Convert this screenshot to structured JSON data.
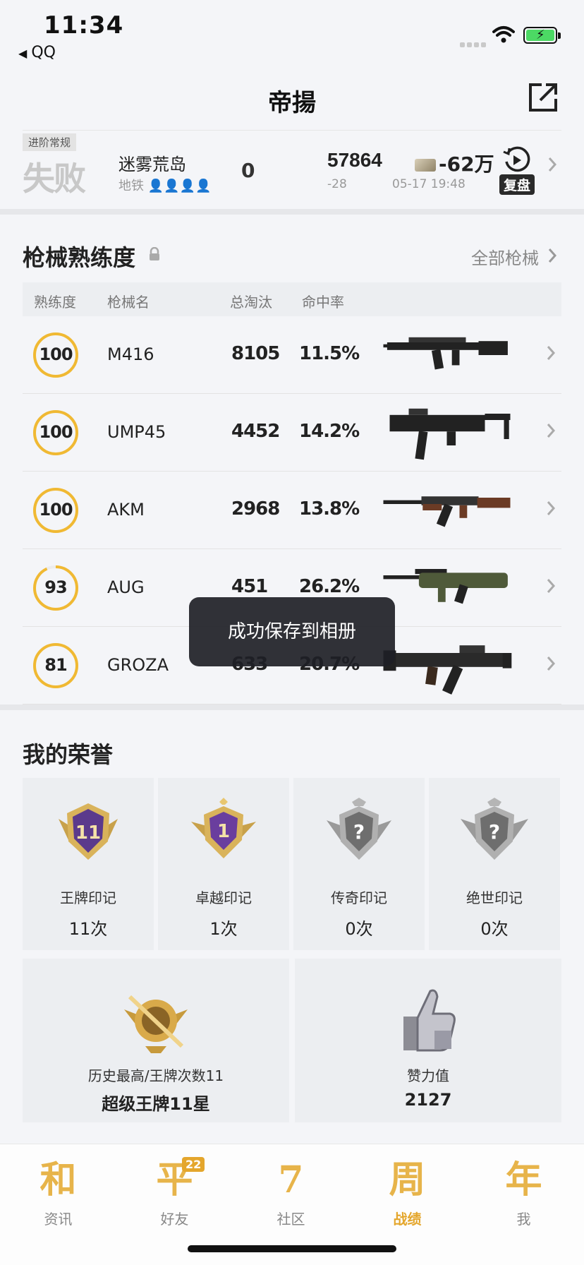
{
  "status": {
    "time": "11:34",
    "back_app": "QQ"
  },
  "header": {
    "title": "帝揚"
  },
  "match": {
    "mode": "进阶常规",
    "result": "失败",
    "map": "迷雾荒岛",
    "map_sub": "地铁",
    "kills": "0",
    "score": "57864",
    "score_delta": "-28",
    "money": "-62万",
    "time": "05-17 19:48",
    "replay_label": "复盘"
  },
  "weapons": {
    "title": "枪械熟练度",
    "all_label": "全部枪械",
    "headers": {
      "mastery": "熟练度",
      "name": "枪械名",
      "kills": "总淘汰",
      "accuracy": "命中率"
    },
    "rows": [
      {
        "mastery": "100",
        "level": 1.0,
        "name": "M416",
        "kills": "8105",
        "accuracy": "11.5%"
      },
      {
        "mastery": "100",
        "level": 1.0,
        "name": "UMP45",
        "kills": "4452",
        "accuracy": "14.2%"
      },
      {
        "mastery": "100",
        "level": 1.0,
        "name": "AKM",
        "kills": "2968",
        "accuracy": "13.8%"
      },
      {
        "mastery": "93",
        "level": 0.93,
        "name": "AUG",
        "kills": "451",
        "accuracy": "26.2%"
      },
      {
        "mastery": "81",
        "level": 1.0,
        "name": "GROZA",
        "kills": "633",
        "accuracy": "20.7%"
      }
    ]
  },
  "toast": {
    "text": "成功保存到相册"
  },
  "honors": {
    "title": "我的荣誉",
    "cards": [
      {
        "name": "王牌印记",
        "count": "11次",
        "badge_text": "11"
      },
      {
        "name": "卓越印记",
        "count": "1次",
        "badge_text": "1"
      },
      {
        "name": "传奇印记",
        "count": "0次",
        "badge_text": "?"
      },
      {
        "name": "绝世印记",
        "count": "0次",
        "badge_text": "?"
      }
    ],
    "best": {
      "label": "历史最高/王牌次数11",
      "value": "超级王牌11星"
    },
    "likes": {
      "label": "赞力值",
      "value": "2127"
    }
  },
  "tabs": [
    {
      "glyph": "和",
      "label": "资讯"
    },
    {
      "glyph": "平",
      "label": "好友",
      "badge": "22"
    },
    {
      "glyph": "7",
      "label": "社区"
    },
    {
      "glyph": "周",
      "label": "战绩"
    },
    {
      "glyph": "年",
      "label": "我"
    }
  ],
  "colors": {
    "accent": "#e4a62c",
    "ring": "#f0b933",
    "toast_bg": "#1e2026"
  }
}
